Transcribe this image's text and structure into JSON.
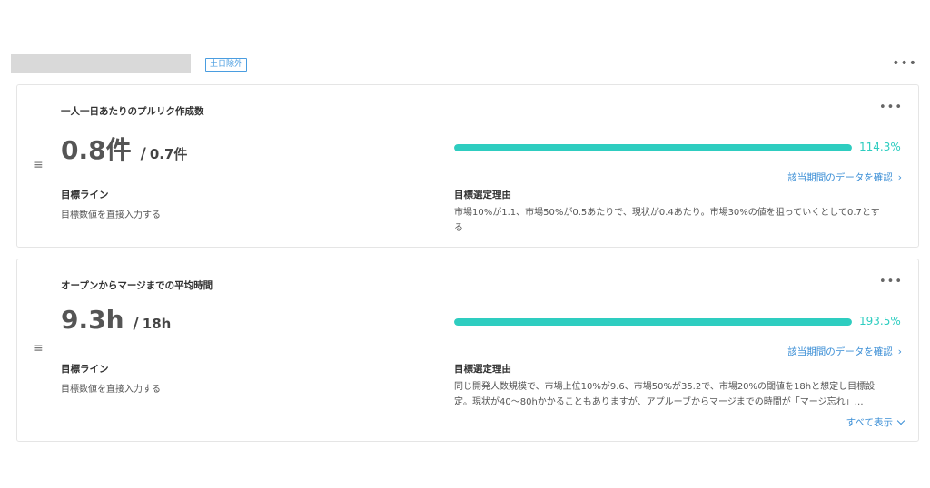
{
  "header": {
    "badge_label": "土日除外",
    "more_label": "•••"
  },
  "colors": {
    "accent": "#2ecdc0",
    "link": "#3c8fd6"
  },
  "cards": [
    {
      "title": "一人一日あたりのプルリク作成数",
      "more_label": "•••",
      "drag_label": "≡",
      "value": "0.8件",
      "separator": "/",
      "target": "0.7件",
      "progress_fraction": 1.0,
      "percent": "114.3%",
      "view_link": "該当期間のデータを確認",
      "goal_label": "目標ライン",
      "goal_desc": "目標数値を直接入力する",
      "reason_label": "目標選定理由",
      "reason_line1": "市場10%が1.1、市場50%が0.5あたりで、現状が0.4あたり。市場30%の値を狙っていくとして0.7とす",
      "reason_line2": "る"
    },
    {
      "title": "オープンからマージまでの平均時間",
      "more_label": "•••",
      "drag_label": "≡",
      "value": "9.3h",
      "separator": "/",
      "target": "18h",
      "progress_fraction": 1.0,
      "percent": "193.5%",
      "view_link": "該当期間のデータを確認",
      "goal_label": "目標ライン",
      "goal_desc": "目標数値を直接入力する",
      "reason_label": "目標選定理由",
      "reason_line1": "同じ開発人数規模で、市場上位10%が9.6、市場50%が35.2で、市場20%の閾値を18hと想定し目標設",
      "reason_line2": "定。現状が40〜80hかかることもありますが、アプルーブからマージまでの時間が「マージ忘れ」…",
      "show_all": "すべて表示"
    }
  ]
}
